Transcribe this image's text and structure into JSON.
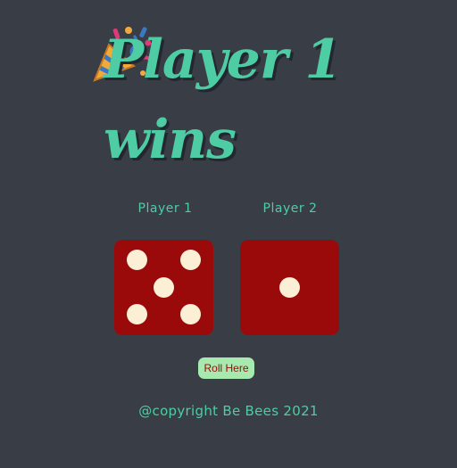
{
  "header": {
    "title": "Player 1 wins",
    "icon": "party-popper-icon"
  },
  "players": [
    {
      "label": "Player 1",
      "die_value": 5
    },
    {
      "label": "Player 2",
      "die_value": 1
    }
  ],
  "roll_button": {
    "label": "Roll Here"
  },
  "footer": {
    "text": "@copyright Be Bees 2021"
  },
  "colors": {
    "background": "#393e46",
    "accent": "#4ecca3",
    "die_face": "#9b0a0a",
    "pip": "#fbefd5",
    "button_bg": "#a7e9af"
  }
}
